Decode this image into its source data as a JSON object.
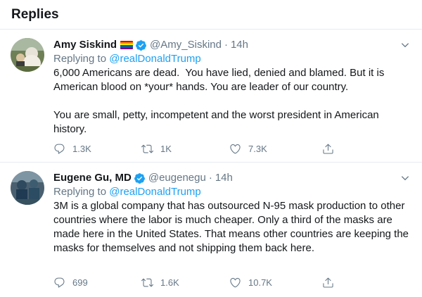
{
  "header": {
    "title": "Replies"
  },
  "replies": [
    {
      "name": "Amy Siskind",
      "handle": "@Amy_Siskind",
      "separator": "·",
      "time": "14h",
      "replying_prefix": "Replying to ",
      "replying_to": "@realDonaldTrump",
      "text": "6,000 Americans are dead.  You have lied, denied and blamed. But it is American blood on *your* hands. You are leader of our country.\n\nYou are small, petty, incompetent and the worst president in American history.",
      "reply_count": "1.3K",
      "retweet_count": "1K",
      "like_count": "7.3K"
    },
    {
      "name": "Eugene Gu, MD",
      "handle": "@eugenegu",
      "separator": "·",
      "time": "14h",
      "replying_prefix": "Replying to ",
      "replying_to": "@realDonaldTrump",
      "text": "3M is a global company that has outsourced N-95 mask production to other countries where the labor is much cheaper. Only a third of the masks are made here in the United States. That means other countries are keeping the masks for themselves and not shipping them back here.",
      "reply_count": "699",
      "retweet_count": "1.6K",
      "like_count": "10.7K"
    }
  ],
  "colors": {
    "accent": "#1da1f2",
    "secondary_text": "#657786",
    "border": "#e6ecf0"
  },
  "icons": [
    "verified-badge-icon",
    "rainbow-flag-icon",
    "chevron-down-icon",
    "reply-icon",
    "retweet-icon",
    "like-icon",
    "share-icon"
  ]
}
